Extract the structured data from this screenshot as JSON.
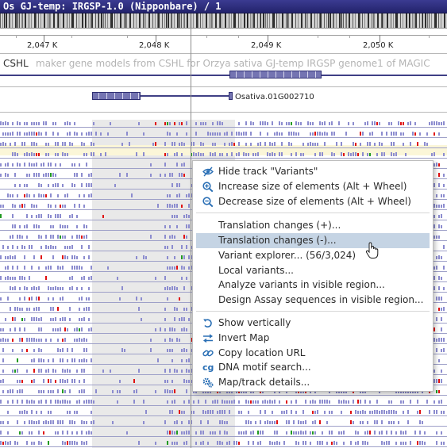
{
  "window": {
    "title": "Os GJ-temp: IRGSP-1.0 (Nipponbare) / 1"
  },
  "ruler": {
    "ticks": [
      "2,047 K",
      "2,048 K",
      "2,049 K",
      "2,050 K"
    ]
  },
  "cshl_track": {
    "label": "CSHL",
    "description": "maker gene models from CSHL for Orzya sativa GJ-temp IRGSP genome1 of MAGIC"
  },
  "gene_track": {
    "gene_label": "Osativa.01G002710"
  },
  "context_menu": {
    "items": [
      {
        "label": "Hide track \"Variants\"",
        "icon": "eye-hide-icon"
      },
      {
        "label": "Increase size of elements (Alt + Wheel)",
        "icon": "zoom-in-icon"
      },
      {
        "label": "Decrease size of elements (Alt + Wheel)",
        "icon": "zoom-out-icon"
      },
      {
        "label": "Translation changes (+)...",
        "icon": ""
      },
      {
        "label": "Translation changes (-)...",
        "icon": "",
        "state": "hovered"
      },
      {
        "label": "Variant explorer... (56/3,024)",
        "icon": ""
      },
      {
        "label": "Local variants...",
        "icon": ""
      },
      {
        "label": "Analyze variants in visible region...",
        "icon": ""
      },
      {
        "label": "Design Assay sequences in visible region...",
        "icon": ""
      },
      {
        "label": "Show vertically",
        "icon": "rotate-icon"
      },
      {
        "label": "Invert Map",
        "icon": "swap-arrows-icon"
      },
      {
        "label": "Copy location URL",
        "icon": "link-icon"
      },
      {
        "label": "DNA motif search...",
        "icon": "cg-icon",
        "icon_text": "cg"
      },
      {
        "label": "Map/track details...",
        "icon": "gears-icon"
      }
    ]
  },
  "colors": {
    "title_bar": "#2b2b78",
    "variant_normal": "#8c8ccf",
    "variant_snp_red": "#e01010",
    "variant_snp_green": "#209a20",
    "selection_shade": "#e9e9e9",
    "menu_hover": "#c5d4e4",
    "menu_icon_blue": "#2a6fb5"
  }
}
